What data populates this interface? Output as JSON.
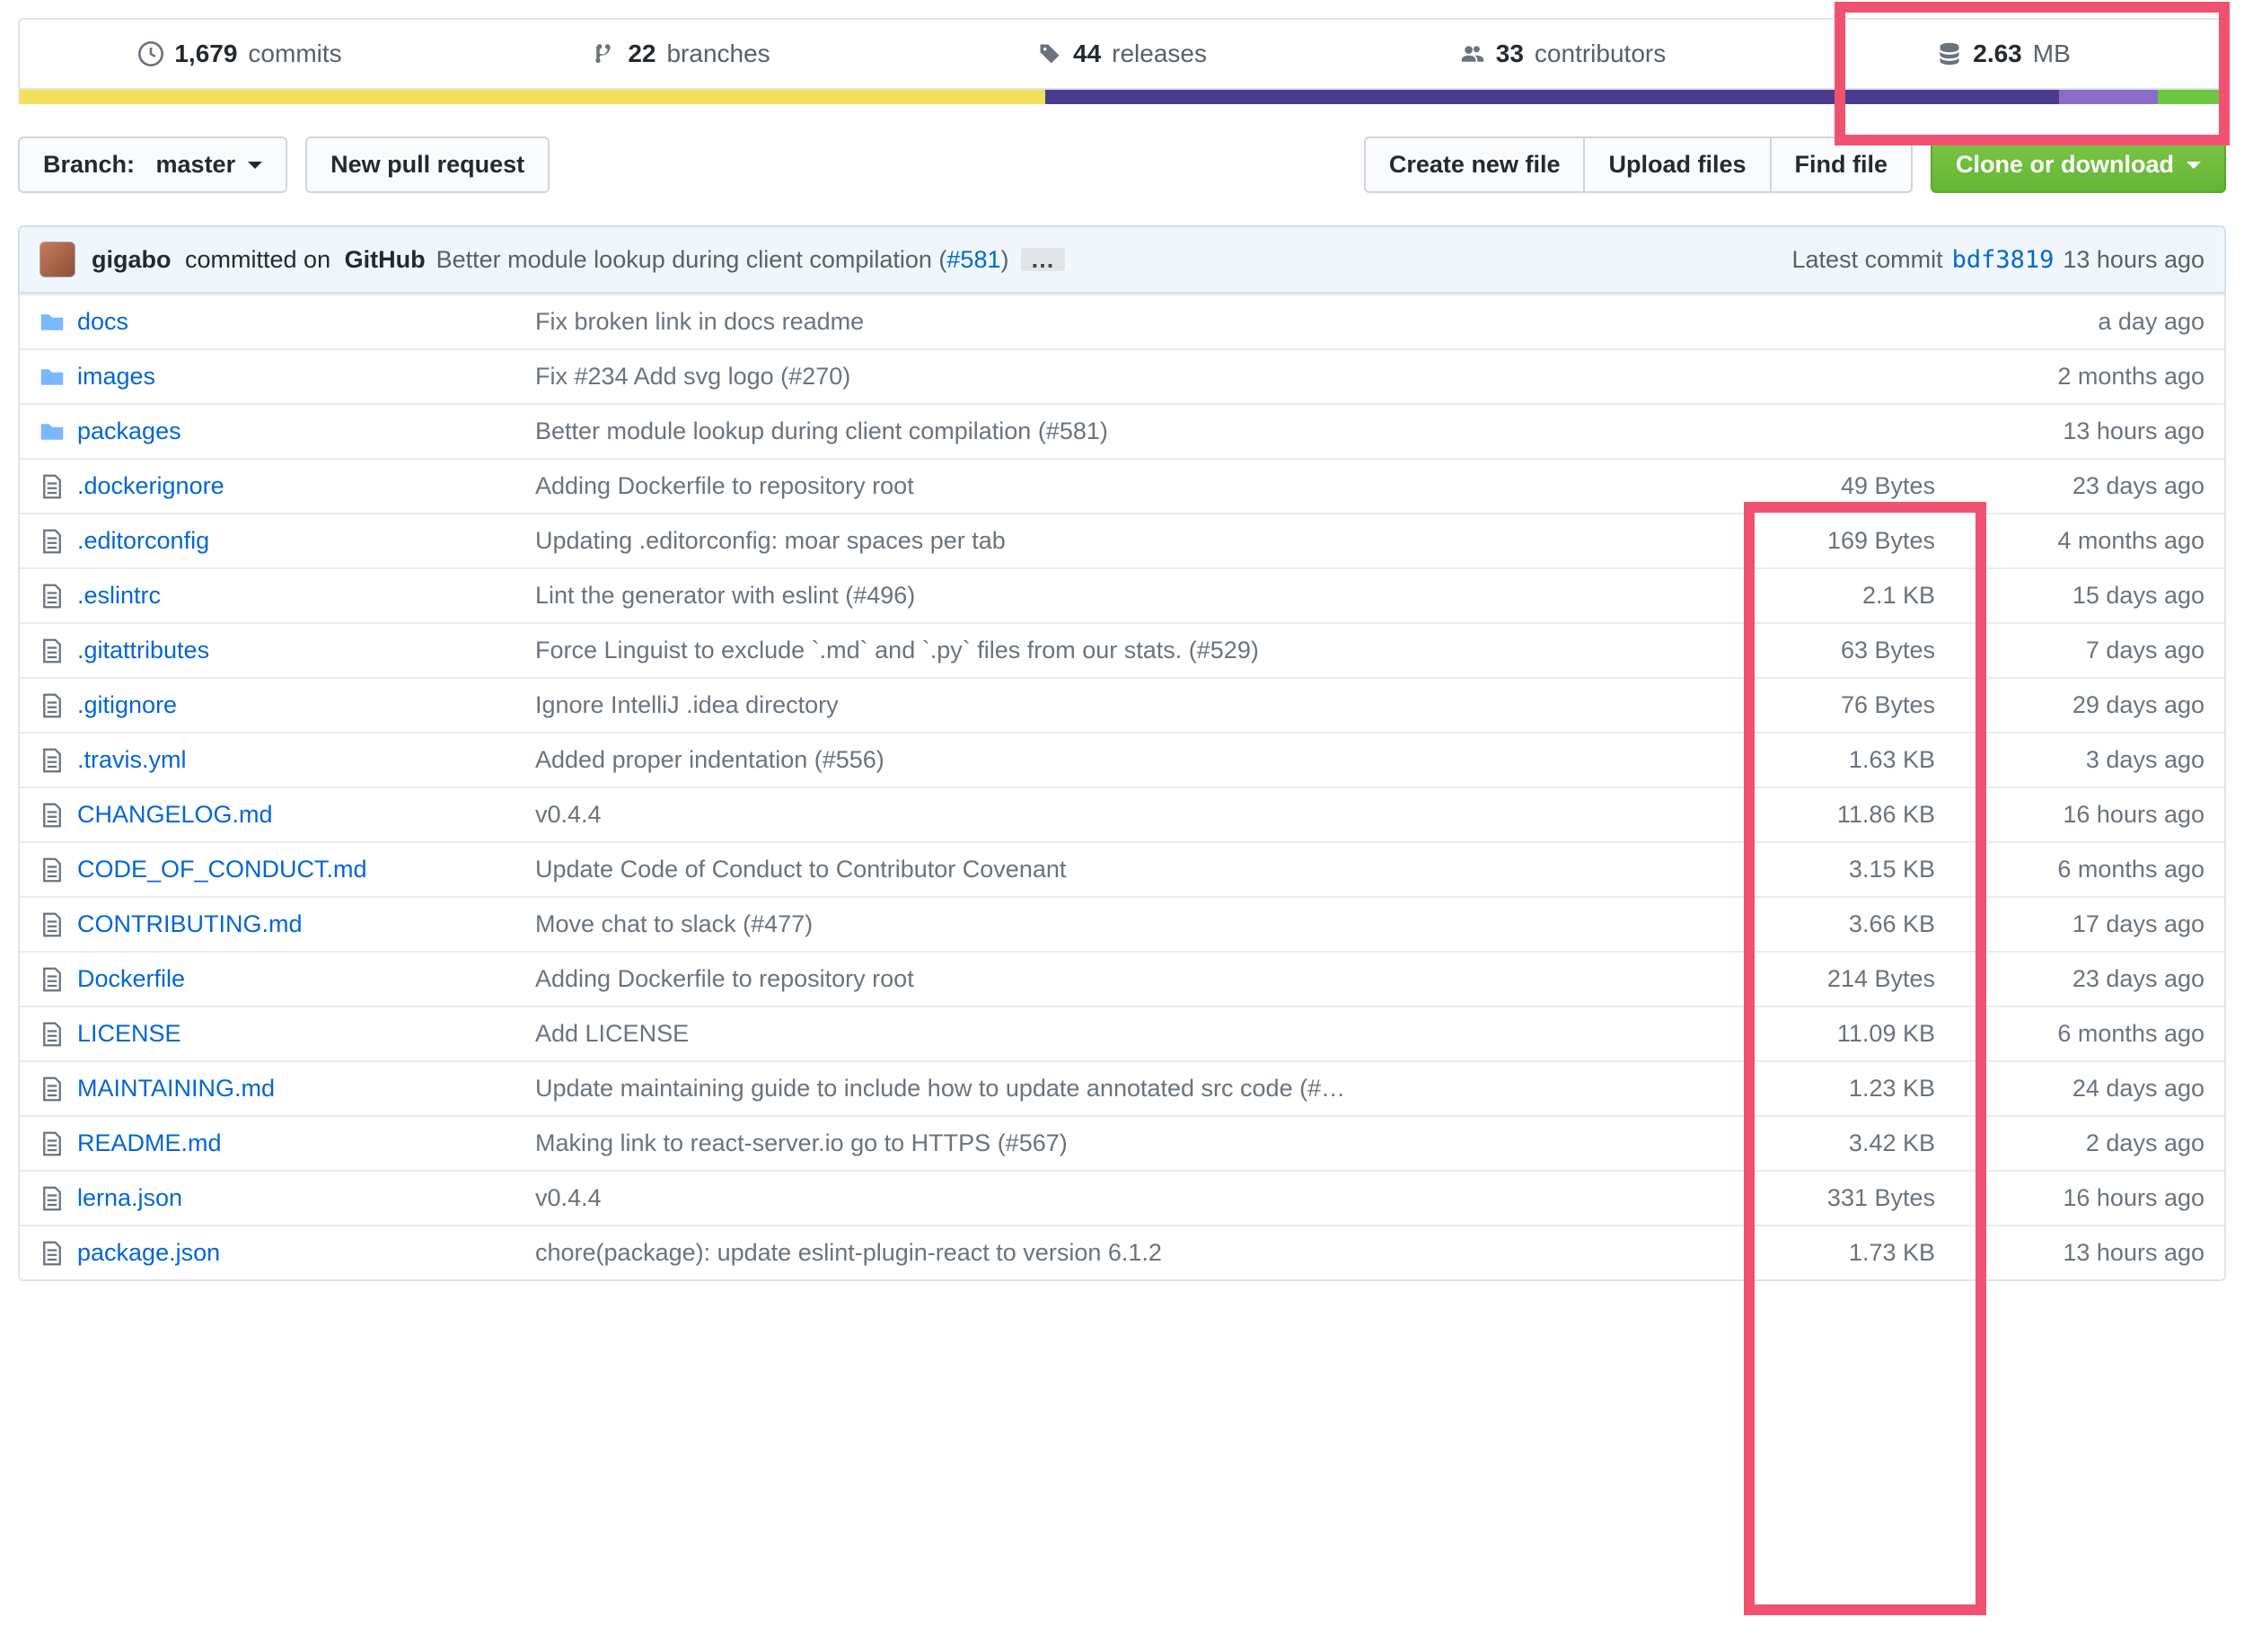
{
  "stats": {
    "commits": {
      "count": "1,679",
      "label": "commits"
    },
    "branches": {
      "count": "22",
      "label": "branches"
    },
    "releases": {
      "count": "44",
      "label": "releases"
    },
    "contributors": {
      "count": "33",
      "label": "contributors"
    },
    "size": {
      "count": "2.63",
      "label": "MB"
    }
  },
  "toolbar": {
    "branch_label": "Branch:",
    "branch_name": "master",
    "new_pr": "New pull request",
    "create_new_file": "Create new file",
    "upload_files": "Upload files",
    "find_file": "Find file",
    "clone_download": "Clone or download"
  },
  "commit": {
    "author": "gigabo",
    "committed_on": "committed on",
    "github": "GitHub",
    "message": "Better module lookup during client compilation (",
    "pr": "#581",
    "message_end": ")",
    "ellipsis": "…",
    "latest_label": "Latest commit",
    "sha": "bdf3819",
    "time": "13 hours ago"
  },
  "files": [
    {
      "type": "dir",
      "name": "docs",
      "msg": "Fix broken link in docs readme",
      "size": "",
      "time": "a day ago"
    },
    {
      "type": "dir",
      "name": "images",
      "msg": "Fix #234 Add svg logo (#270)",
      "size": "",
      "time": "2 months ago"
    },
    {
      "type": "dir",
      "name": "packages",
      "msg": "Better module lookup during client compilation (#581)",
      "size": "",
      "time": "13 hours ago"
    },
    {
      "type": "file",
      "name": ".dockerignore",
      "msg": "Adding Dockerfile to repository root",
      "size": "49 Bytes",
      "time": "23 days ago"
    },
    {
      "type": "file",
      "name": ".editorconfig",
      "msg": "Updating .editorconfig: moar spaces per tab",
      "size": "169 Bytes",
      "time": "4 months ago"
    },
    {
      "type": "file",
      "name": ".eslintrc",
      "msg": "Lint the generator with eslint (#496)",
      "size": "2.1 KB",
      "time": "15 days ago"
    },
    {
      "type": "file",
      "name": ".gitattributes",
      "msg": "Force Linguist to exclude `.md` and `.py` files from our stats. (#529)",
      "size": "63 Bytes",
      "time": "7 days ago"
    },
    {
      "type": "file",
      "name": ".gitignore",
      "msg": "Ignore IntelliJ .idea directory",
      "size": "76 Bytes",
      "time": "29 days ago"
    },
    {
      "type": "file",
      "name": ".travis.yml",
      "msg": "Added proper indentation (#556)",
      "size": "1.63 KB",
      "time": "3 days ago"
    },
    {
      "type": "file",
      "name": "CHANGELOG.md",
      "msg": "v0.4.4",
      "size": "11.86 KB",
      "time": "16 hours ago"
    },
    {
      "type": "file",
      "name": "CODE_OF_CONDUCT.md",
      "msg": "Update Code of Conduct to Contributor Covenant",
      "size": "3.15 KB",
      "time": "6 months ago"
    },
    {
      "type": "file",
      "name": "CONTRIBUTING.md",
      "msg": "Move chat to slack (#477)",
      "size": "3.66 KB",
      "time": "17 days ago"
    },
    {
      "type": "file",
      "name": "Dockerfile",
      "msg": "Adding Dockerfile to repository root",
      "size": "214 Bytes",
      "time": "23 days ago"
    },
    {
      "type": "file",
      "name": "LICENSE",
      "msg": "Add LICENSE",
      "size": "11.09 KB",
      "time": "6 months ago"
    },
    {
      "type": "file",
      "name": "MAINTAINING.md",
      "msg": "Update maintaining guide to include how to update annotated src code (#…",
      "size": "1.23 KB",
      "time": "24 days ago"
    },
    {
      "type": "file",
      "name": "README.md",
      "msg": "Making link to react-server.io go to HTTPS (#567)",
      "size": "3.42 KB",
      "time": "2 days ago"
    },
    {
      "type": "file",
      "name": "lerna.json",
      "msg": "v0.4.4",
      "size": "331 Bytes",
      "time": "16 hours ago"
    },
    {
      "type": "file",
      "name": "package.json",
      "msg": "chore(package): update eslint-plugin-react to version 6.1.2",
      "size": "1.73 KB",
      "time": "13 hours ago"
    }
  ]
}
